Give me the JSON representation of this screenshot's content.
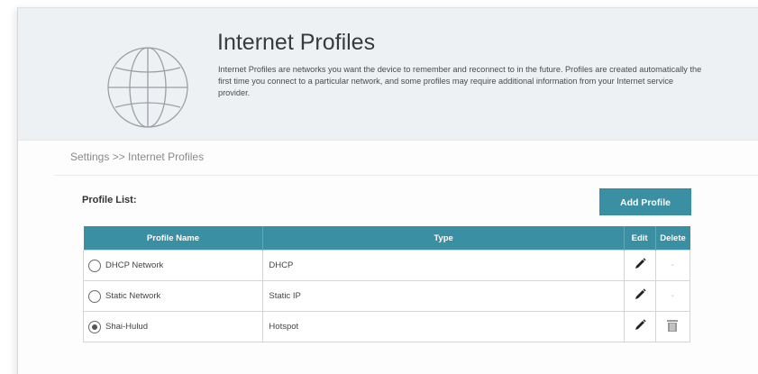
{
  "header": {
    "title": "Internet Profiles",
    "description": "Internet Profiles are networks you want the device to remember and reconnect to in the future. Profiles are created automatically the first time you connect to a particular network, and some profiles may require additional information from your Internet service provider.",
    "icon": "globe-icon"
  },
  "breadcrumb": "Settings >> Internet Profiles",
  "profile_list": {
    "title": "Profile List:",
    "add_button": "Add Profile",
    "columns": [
      "Profile Name",
      "Type",
      "Edit",
      "Delete"
    ],
    "rows": [
      {
        "name": "DHCP Network",
        "type": "DHCP",
        "selected": false,
        "delete": "-"
      },
      {
        "name": "Static Network",
        "type": "Static IP",
        "selected": false,
        "delete": "-"
      },
      {
        "name": "Shai-Hulud",
        "type": "Hotspot",
        "selected": true,
        "delete": "trash-icon"
      }
    ]
  },
  "colors": {
    "accent": "#3a8fa3",
    "header_bg": "#eef1f3"
  }
}
